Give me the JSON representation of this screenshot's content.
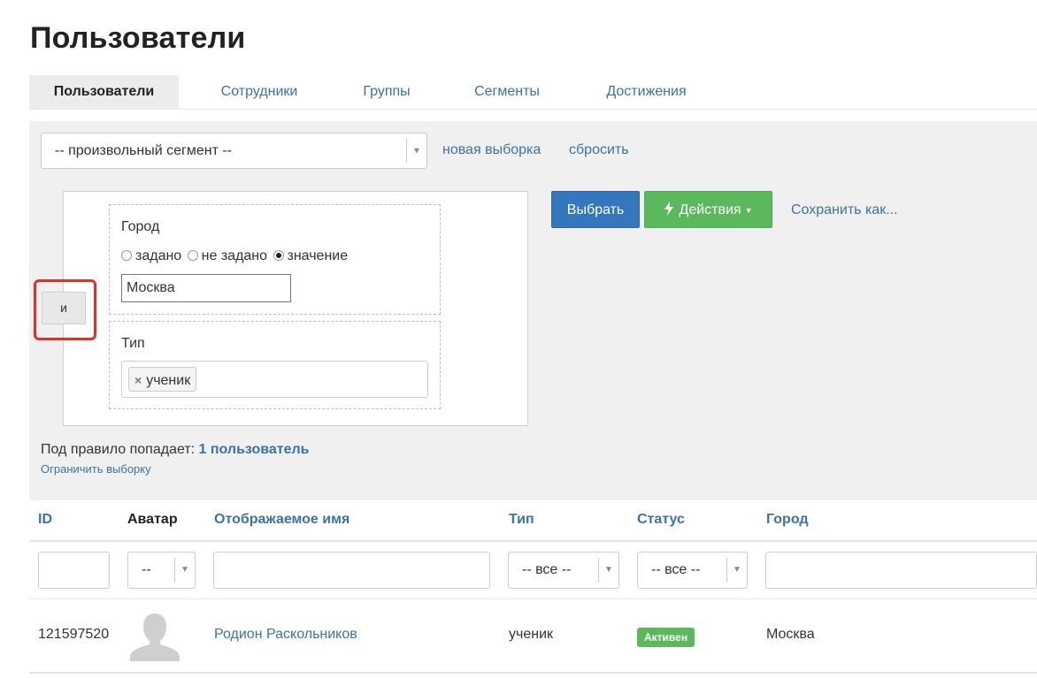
{
  "page": {
    "title": "Пользователи"
  },
  "tabs": [
    {
      "label": "Пользователи",
      "active": true
    },
    {
      "label": "Сотрудники",
      "active": false
    },
    {
      "label": "Группы",
      "active": false
    },
    {
      "label": "Сегменты",
      "active": false
    },
    {
      "label": "Достижения",
      "active": false
    }
  ],
  "filter": {
    "segment_select": "-- произвольный сегмент --",
    "new_selection_link": "новая выборка",
    "reset_link": "сбросить",
    "logic_button": "и",
    "conditions": {
      "city": {
        "label": "Город",
        "options": [
          {
            "label": "задано",
            "checked": false
          },
          {
            "label": "не задано",
            "checked": false
          },
          {
            "label": "значение",
            "checked": true
          }
        ],
        "value": "Москва"
      },
      "type": {
        "label": "Тип",
        "tags": [
          "ученик"
        ]
      }
    },
    "select_button": "Выбрать",
    "actions_button": "Действия",
    "save_as_link": "Сохранить как...",
    "match_prefix": "Под правило попадает:",
    "match_count": "1 пользователь",
    "limit_link": "Ограничить выборку"
  },
  "table": {
    "columns": [
      "ID",
      "Аватар",
      "Отображаемое имя",
      "Тип",
      "Статус",
      "Город"
    ],
    "filters": {
      "avatar": "--",
      "type": "-- все --",
      "status": "-- все --"
    },
    "rows": [
      {
        "id": "121597520",
        "name": "Родион Раскольников",
        "type": "ученик",
        "status": "Активен",
        "city": "Москва"
      }
    ]
  },
  "colors": {
    "link": "#3b73a8",
    "primary_button": "#3577bd",
    "success": "#5cb85c",
    "highlight": "#d9332b"
  }
}
